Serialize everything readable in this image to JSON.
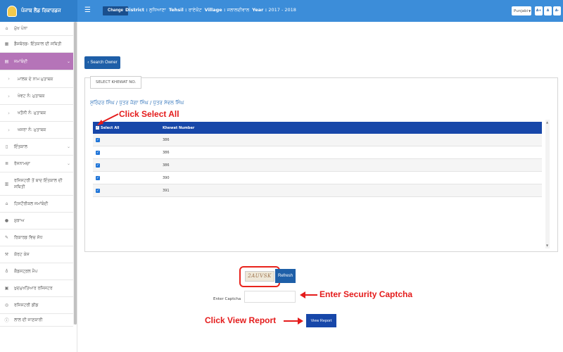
{
  "header": {
    "app_title": "ਪੰਜਾਬ ਲੈਂਡ ਰਿਕਾਰਡਜ",
    "menu_icon": "hamburger-icon",
    "change_label": "Change",
    "district_label": "District :",
    "district_value": "ਲੁਧਿਆਣਾ",
    "tehsil_label": "Tehsil :",
    "tehsil_value": "ਰਾਏਕੋਟ",
    "village_label": "Village :",
    "village_value": "ਜਲਾਲਦੀਵਾਲ",
    "year_label": "Year :",
    "year_value": "2017 - 2018",
    "language": "Punjabi",
    "font_buttons": [
      "A+",
      "A",
      "A-"
    ],
    "brand_color": "#3c8dd9"
  },
  "sidebar": {
    "items": [
      {
        "label": "ਮੁੱਖ ਪੰਨਾ",
        "icon": "home-icon"
      },
      {
        "label": "ਡੈਸ਼ਬੋਰਡ- ਇੰਤਕਾਲ ਦੀ ਸਥਿਤੀ",
        "icon": "dashboard-icon"
      },
      {
        "label": "ਜਮਾਂਬੰਦੀ",
        "icon": "book-icon"
      },
      {
        "label": "ਮਾਲਕ ਦੇ ਨਾਮ ਮੁਤਾਬਕ",
        "icon": "chevron-right-icon"
      },
      {
        "label": "ਖੇਵਟ ਨੰ: ਮੁਤਾਬਕ",
        "icon": "chevron-right-icon"
      },
      {
        "label": "ਖਤੌਨੀ ਨੰ: ਮੁਤਾਬਕ",
        "icon": "chevron-right-icon"
      },
      {
        "label": "ਖਸਰਾ ਨੰ: ਮੁਤਾਬਕ",
        "icon": "chevron-right-icon"
      },
      {
        "label": "ਇੰਤਕਾਲ",
        "icon": "file-icon"
      },
      {
        "label": "ਰੋਜਨਾਮਚਾ",
        "icon": "list-icon"
      },
      {
        "label": "ਰਜਿਸਟਰੀ ਤੋਂ ਬਾਦ ਇੰਤਕਾਲ ਦੀ ਸਥਿਤੀ",
        "icon": "building-icon"
      },
      {
        "label": "ਹਿਸਟੌਰੀਕਲ ਜਮਾਂਬੰਦੀ",
        "icon": "bank-icon"
      },
      {
        "label": "ਸੁਝਾਅ",
        "icon": "chat-icon"
      },
      {
        "label": "ਰਿਕਾਰਡ ਵਿਚ ਸੋਧ",
        "icon": "edit-icon"
      },
      {
        "label": "ਕੋਰਟ ਕੇਸ",
        "icon": "gavel-icon"
      },
      {
        "label": "ਕੈਡਸਟ੍ਰਲ ਮੈਪ",
        "icon": "map-pin-icon"
      },
      {
        "label": "ਖੁਦਮੁਖਤਿਆਰ ਰਜਿਸਟਰ",
        "icon": "register-icon"
      },
      {
        "label": "ਰਜਿਸਟਰੀ ਡੀਡ",
        "icon": "deed-icon"
      },
      {
        "label": "ਲਾਲ ਦੀ ਜਾਣਕਾਰੀ",
        "icon": "info-icon"
      }
    ]
  },
  "main": {
    "search_owner_label": "Search Owner",
    "select_khewat_title": "SELECT KHEWAT NO.",
    "owners_text": "ਸੁਰਿੰਦਰ ਸਿੰਘ / ਪੁੱਤਰ ਜੋਗਾ ਸਿੰਘ / ਪੁੱਤਰ ਸੇਵਲ ਸਿੰਘ",
    "table": {
      "headers": [
        "Select All",
        "Khewat Number"
      ],
      "rows": [
        {
          "khewat": "386"
        },
        {
          "khewat": "386"
        },
        {
          "khewat": "386"
        },
        {
          "khewat": "390"
        },
        {
          "khewat": "391"
        }
      ]
    },
    "captcha": {
      "code": "2AUVSK",
      "refresh_label": "Refresh",
      "input_label": "Enter Captcha",
      "input_value": ""
    },
    "view_report_label": "View Report"
  },
  "annotations": {
    "select_all": "Click Select All",
    "security_captcha": "Enter Security Captcha",
    "view_report": "Click View Report",
    "color": "#e41b1b"
  }
}
